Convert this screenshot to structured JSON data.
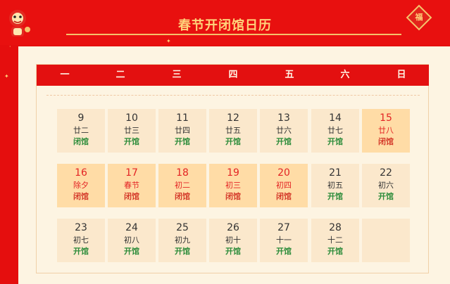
{
  "header": {
    "title": "春节开闭馆日历",
    "badge": "福"
  },
  "weekdays": [
    "一",
    "二",
    "三",
    "四",
    "五",
    "六",
    "日"
  ],
  "days": [
    {
      "day": "9",
      "lunar": "廿二",
      "status": "闭馆",
      "closed": false
    },
    {
      "day": "10",
      "lunar": "廿三",
      "status": "开馆",
      "closed": false
    },
    {
      "day": "11",
      "lunar": "廿四",
      "status": "开馆",
      "closed": false
    },
    {
      "day": "12",
      "lunar": "廿五",
      "status": "开馆",
      "closed": false
    },
    {
      "day": "13",
      "lunar": "廿六",
      "status": "开馆",
      "closed": false
    },
    {
      "day": "14",
      "lunar": "廿七",
      "status": "开馆",
      "closed": false
    },
    {
      "day": "15",
      "lunar": "廿八",
      "status": "闭馆",
      "closed": true
    },
    {
      "day": "16",
      "lunar": "除夕",
      "status": "闭馆",
      "closed": true
    },
    {
      "day": "17",
      "lunar": "春节",
      "status": "闭馆",
      "closed": true
    },
    {
      "day": "18",
      "lunar": "初二",
      "status": "闭馆",
      "closed": true
    },
    {
      "day": "19",
      "lunar": "初三",
      "status": "闭馆",
      "closed": true
    },
    {
      "day": "20",
      "lunar": "初四",
      "status": "闭馆",
      "closed": true
    },
    {
      "day": "21",
      "lunar": "初五",
      "status": "开馆",
      "closed": false
    },
    {
      "day": "22",
      "lunar": "初六",
      "status": "开馆",
      "closed": false
    },
    {
      "day": "23",
      "lunar": "初七",
      "status": "开馆",
      "closed": false
    },
    {
      "day": "24",
      "lunar": "初八",
      "status": "开馆",
      "closed": false
    },
    {
      "day": "25",
      "lunar": "初九",
      "status": "开馆",
      "closed": false
    },
    {
      "day": "26",
      "lunar": "初十",
      "status": "开馆",
      "closed": false
    },
    {
      "day": "27",
      "lunar": "十一",
      "status": "开馆",
      "closed": false
    },
    {
      "day": "28",
      "lunar": "十二",
      "status": "开馆",
      "closed": false
    }
  ],
  "colors": {
    "background_red": "#e50e0e",
    "gold": "#ffd37a",
    "panel_cream": "#fdf4e2",
    "cell_open": "#fbe8cc",
    "cell_closed": "#ffdca6",
    "text_closed": "#e32424",
    "text_open_status": "#2c8c3a"
  }
}
